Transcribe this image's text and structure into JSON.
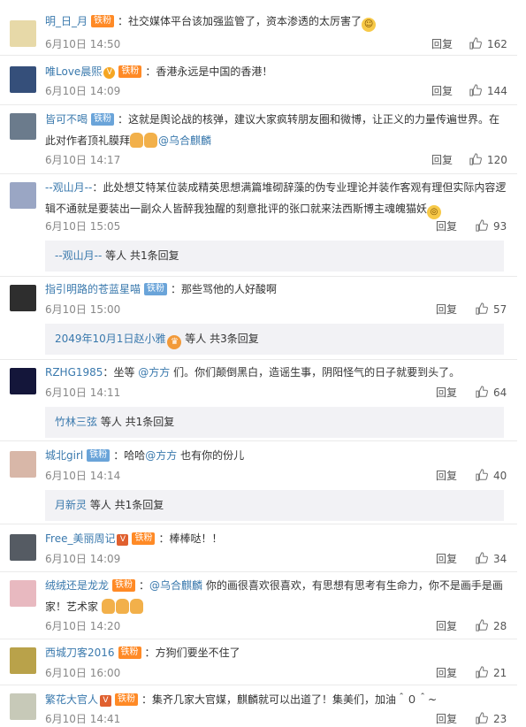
{
  "comments": [
    {
      "user": "明_日_月",
      "badges": [
        "铁粉"
      ],
      "sep": "：",
      "text": "社交媒体平台该加强监管了，资本渗透的太厉害了",
      "date": "6月10日 14:50",
      "reply": "回复",
      "likes": "162",
      "avatar_color": "#e7d9a8"
    },
    {
      "user": "唯Love晨熙",
      "badges": [
        "铁粉"
      ],
      "sep": "：",
      "text": "香港永远是中国的香港！",
      "date": "6月10日 14:09",
      "reply": "回复",
      "likes": "144",
      "avatar_color": "#354f7a"
    },
    {
      "user": "皆可不喝",
      "badges": [
        "铁粉"
      ],
      "sep": "：",
      "text": "这就是舆论战的核弹，建议大家疯转朋友圈和微博，让正义的力量传遍世界。在此对作者顶礼膜拜",
      "mention": "@乌合麒麟",
      "date": "6月10日 14:17",
      "reply": "回复",
      "likes": "120",
      "avatar_color": "#6b7b8c"
    },
    {
      "user": "--观山月--",
      "sep": "：",
      "text": "此处想艾特某位装成精英思想满篇堆砌辞藻的伪专业理论并装作客观有理但实际内容逻辑不通就是要装出一副众人皆醉我独醒的刻意批评的张口就来法西斯博主魂魄猫妖",
      "date": "6月10日 15:05",
      "reply": "回复",
      "likes": "93",
      "avatar_color": "#9aa6c4",
      "sub": {
        "name": "--观山月--",
        "rest": " 等人 共1条回复"
      }
    },
    {
      "user": "指引明路的苍蓝星喵",
      "badges": [
        "铁粉"
      ],
      "sep": "：",
      "text": "那些骂他的人好酸啊",
      "date": "6月10日 15:00",
      "reply": "回复",
      "likes": "57",
      "avatar_color": "#2e2e2e",
      "sub": {
        "name": "2049年10月1日赵小雅",
        "rest": " 等人 共3条回复"
      }
    },
    {
      "user": "RZHG1985",
      "sep": "：",
      "text": "坐等 ",
      "mention": "@方方",
      "text2": " 们。你们颠倒黑白，造谣生事，阴阳怪气的日子就要到头了。",
      "date": "6月10日 14:11",
      "reply": "回复",
      "likes": "64",
      "avatar_color": "#14163a",
      "sub": {
        "name": "竹林三弦",
        "rest": " 等人 共1条回复"
      }
    },
    {
      "user": "城北girl",
      "badges": [
        "铁粉"
      ],
      "sep": "：",
      "text": "哈哈",
      "mention": "@方方",
      "text2": " 也有你的份儿",
      "date": "6月10日 14:14",
      "reply": "回复",
      "likes": "40",
      "avatar_color": "#d8b7a8",
      "sub": {
        "name": "月新灵",
        "rest": " 等人 共1条回复"
      }
    },
    {
      "user": "Free_美丽周记",
      "badges": [
        "铁粉"
      ],
      "sep": "：",
      "text": "棒棒哒！！",
      "date": "6月10日 14:09",
      "reply": "回复",
      "likes": "34",
      "avatar_color": "#555b63"
    },
    {
      "user": "绒绒还是龙龙",
      "badges": [
        "铁粉"
      ],
      "sep": "：",
      "mention": "@乌合麒麟",
      "text": " 你的画很喜欢很喜欢，有思想有思考有生命力，你不是画手是画家！艺术家",
      "date": "6月10日 14:20",
      "reply": "回复",
      "likes": "28",
      "avatar_color": "#e8b9c0"
    },
    {
      "user": "西城刀客2016",
      "badges": [
        "铁粉"
      ],
      "sep": "：",
      "text": "方狗们要坐不住了",
      "date": "6月10日 16:00",
      "reply": "回复",
      "likes": "21",
      "avatar_color": "#b9a24a"
    },
    {
      "user": "繁花大官人",
      "badges": [
        "铁粉"
      ],
      "sep": "：",
      "text": "集齐几家大官媒，麒麟就可以出道了！集美们，加油＾０＾~",
      "date": "6月10日 14:41",
      "reply": "回复",
      "likes": "23",
      "avatar_color": "#c7c9b8"
    }
  ],
  "icons": {
    "like": "thumbs-up-icon",
    "verified": "v-icon",
    "fan": "fan-badge-icon"
  }
}
